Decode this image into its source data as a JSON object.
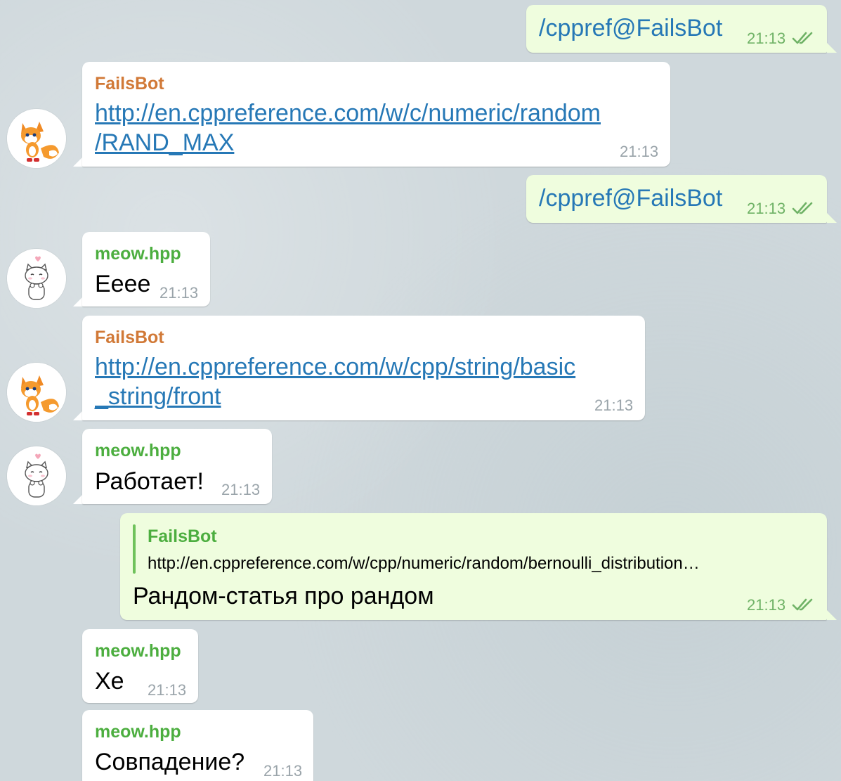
{
  "colors": {
    "background": "#cfd8dc",
    "incoming_bubble": "#ffffff",
    "outgoing_bubble": "#effdde",
    "link": "#2678b6",
    "bot_name": "#d17937",
    "user_name": "#4cae3f",
    "read_check": "#6fb266"
  },
  "messages": [
    {
      "dir": "out",
      "text": "/cppref@FailsBot",
      "time": "21:13",
      "status": "read-check-icon"
    },
    {
      "dir": "in",
      "sender": "FailsBot",
      "avatar": "fox-avatar",
      "link_line1": "http://en.cppreference.com/w/c/numeric/random",
      "link_line2": "/RAND_MAX",
      "time": "21:13"
    },
    {
      "dir": "out",
      "text": "/cppref@FailsBot",
      "time": "21:13",
      "status": "read-check-icon"
    },
    {
      "dir": "in",
      "sender": "meow.hpp",
      "avatar": "cat-avatar",
      "text": "Eeee",
      "time": "21:13"
    },
    {
      "dir": "in",
      "sender": "FailsBot",
      "avatar": "fox-avatar",
      "link_line1": "http://en.cppreference.com/w/cpp/string/basic",
      "link_line2": "_string/front",
      "time": "21:13"
    },
    {
      "dir": "in",
      "sender": "meow.hpp",
      "avatar": "cat-avatar",
      "text": "Работает!",
      "time": "21:13"
    },
    {
      "dir": "out",
      "reply_to": {
        "name": "FailsBot",
        "text": "http://en.cppreference.com/w/cpp/numeric/random/bernoulli_distribution…"
      },
      "text": "Рандом-статья про рандом",
      "time": "21:13",
      "status": "read-check-icon"
    },
    {
      "dir": "in",
      "sender": "meow.hpp",
      "text": "Xe",
      "time": "21:13"
    },
    {
      "dir": "in",
      "sender": "meow.hpp",
      "text": "Совпадение?",
      "time": "21:13"
    }
  ]
}
